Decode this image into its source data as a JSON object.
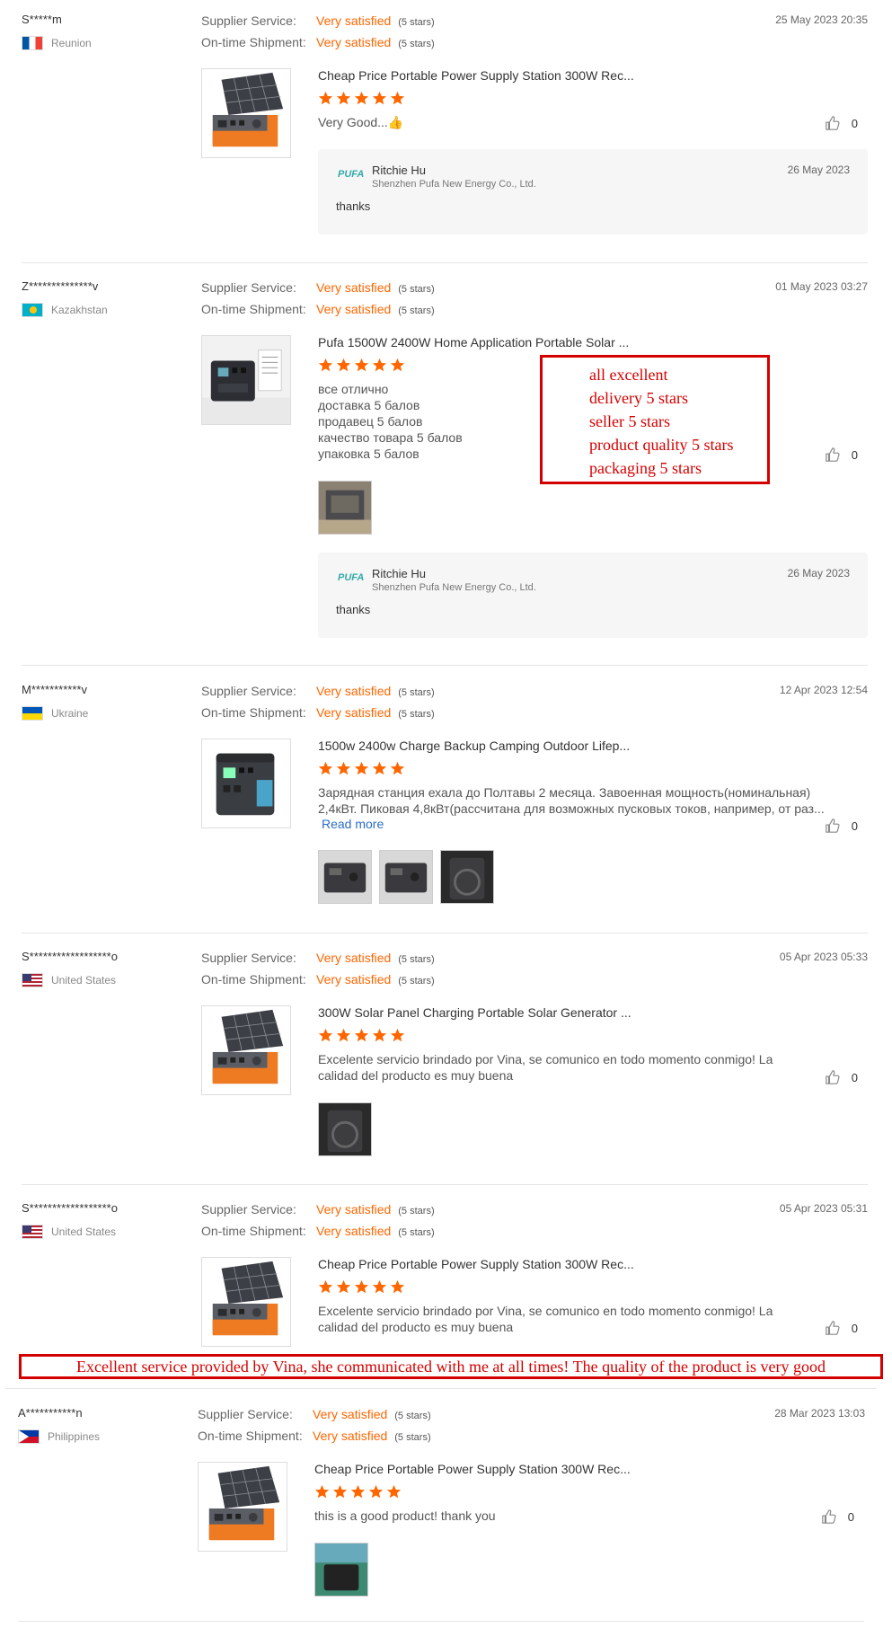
{
  "labels": {
    "supplier_service": "Supplier Service:",
    "ontime_shipment": "On-time Shipment:",
    "satisfied": "Very satisfied",
    "five_stars": "(5 stars)",
    "read_more": "Read more"
  },
  "colors": {
    "accent": "#ff6600",
    "annotation": "#d40000",
    "link": "#2b6cc4"
  },
  "reviews": [
    {
      "user": "S*****m",
      "country": "Reunion",
      "date": "25 May 2023 20:35",
      "product_title": "Cheap Price Portable Power Supply Station 300W Rec...",
      "rating": 5,
      "text": "Very Good...👍",
      "likes": "0",
      "reply": {
        "name": "Ritchie Hu",
        "company": "Shenzhen Pufa New Energy Co., Ltd.",
        "date": "26 May 2023",
        "text": "thanks"
      }
    },
    {
      "user": "Z**************v",
      "country": "Kazakhstan",
      "date": "01 May 2023 03:27",
      "product_title": "Pufa 1500W 2400W Home Application Portable Solar ...",
      "rating": 5,
      "text_lines": [
        "все отлично",
        "доставка 5 балов",
        "продавец 5 балов",
        "качество товара 5 балов",
        "упаковка 5 балов"
      ],
      "likes": "0",
      "reply": {
        "name": "Ritchie Hu",
        "company": "Shenzhen Pufa New Energy Co., Ltd.",
        "date": "26 May 2023",
        "text": "thanks"
      },
      "annotation": [
        "all excellent",
        "delivery 5 stars",
        "seller 5 stars",
        "product quality 5 stars",
        "packaging 5 stars"
      ]
    },
    {
      "user": "M***********v",
      "country": "Ukraine",
      "date": "12 Apr 2023 12:54",
      "product_title": "1500w 2400w Charge Backup Camping Outdoor Lifep...",
      "rating": 5,
      "text_lines": [
        "Зарядная станция ехала до Полтавы 2 месяца. Завоенная мощность(номинальная)",
        "2,4кВт. Пиковая 4,8кВт(рассчитана для возможных пусковых токов, например, от раз..."
      ],
      "likes": "0"
    },
    {
      "user": "S******************o",
      "country": "United States",
      "date": "05 Apr 2023 05:33",
      "product_title": "300W Solar Panel Charging Portable Solar Generator ...",
      "rating": 5,
      "text_lines": [
        "Excelente servicio brindado por Vina, se comunico en todo momento conmigo! La",
        "calidad del producto es muy buena"
      ],
      "likes": "0"
    },
    {
      "user": "S******************o",
      "country": "United States",
      "date": "05 Apr 2023 05:31",
      "product_title": "Cheap Price Portable Power Supply Station 300W Rec...",
      "rating": 5,
      "text_lines": [
        "Excelente servicio brindado por Vina, se comunico en todo momento conmigo! La",
        "calidad del producto es muy buena"
      ],
      "likes": "0"
    },
    {
      "user": "A***********n",
      "country": "Philippines",
      "date": "28 Mar 2023 13:03",
      "product_title": "Cheap Price Portable Power Supply Station 300W Rec...",
      "rating": 5,
      "text": "this is a good product! thank you",
      "likes": "0"
    }
  ],
  "bottom_annotation": "Excellent service provided by Vina, she communicated with me at all times! The quality of the product is very good"
}
